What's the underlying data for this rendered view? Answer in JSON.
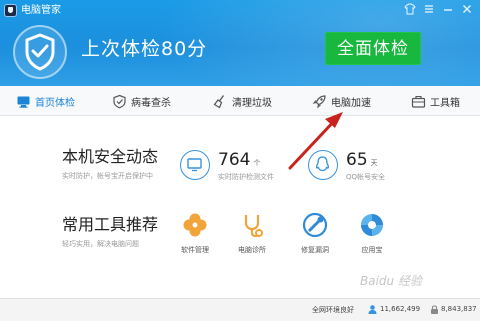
{
  "window": {
    "title": "电脑管家",
    "controls": [
      "shirt-icon",
      "menu-icon",
      "minimize-icon",
      "close-icon"
    ]
  },
  "header": {
    "score_text": "上次体检80分",
    "check_button": "全面体检"
  },
  "nav": {
    "items": [
      {
        "label": "首页体检",
        "icon": "home-icon",
        "active": true
      },
      {
        "label": "病毒查杀",
        "icon": "virus-scan-icon",
        "active": false
      },
      {
        "label": "清理垃圾",
        "icon": "broom-icon",
        "active": false
      },
      {
        "label": "电脑加速",
        "icon": "rocket-icon",
        "active": false
      },
      {
        "label": "工具箱",
        "icon": "toolbox-icon",
        "active": false
      }
    ]
  },
  "security": {
    "title": "本机安全动态",
    "subtitle": "实时防护，帐号宝开启保护中",
    "files_count": "764",
    "files_unit": "个",
    "files_caption": "实时防护检测文件",
    "qq_days": "65",
    "qq_unit": "天",
    "qq_caption": "QQ帐号安全"
  },
  "tools": {
    "title": "常用工具推荐",
    "subtitle": "轻巧实用，解决电脑问题",
    "items": [
      {
        "label": "软件管理",
        "icon": "software-manager-icon"
      },
      {
        "label": "电脑诊所",
        "icon": "stethoscope-icon"
      },
      {
        "label": "修复漏洞",
        "icon": "repair-icon"
      },
      {
        "label": "应用宝",
        "icon": "app-store-icon"
      }
    ]
  },
  "statusbar": {
    "label": "全网环境良好",
    "protected_count": "11,662,499",
    "secondary_count": "8,843,837"
  },
  "watermark": "Baidu 经验",
  "colors": {
    "header_blue": "#1c8fdd",
    "check_green": "#17b83d",
    "accent_blue": "#1a84d6",
    "arrow_red": "#c8231d"
  }
}
